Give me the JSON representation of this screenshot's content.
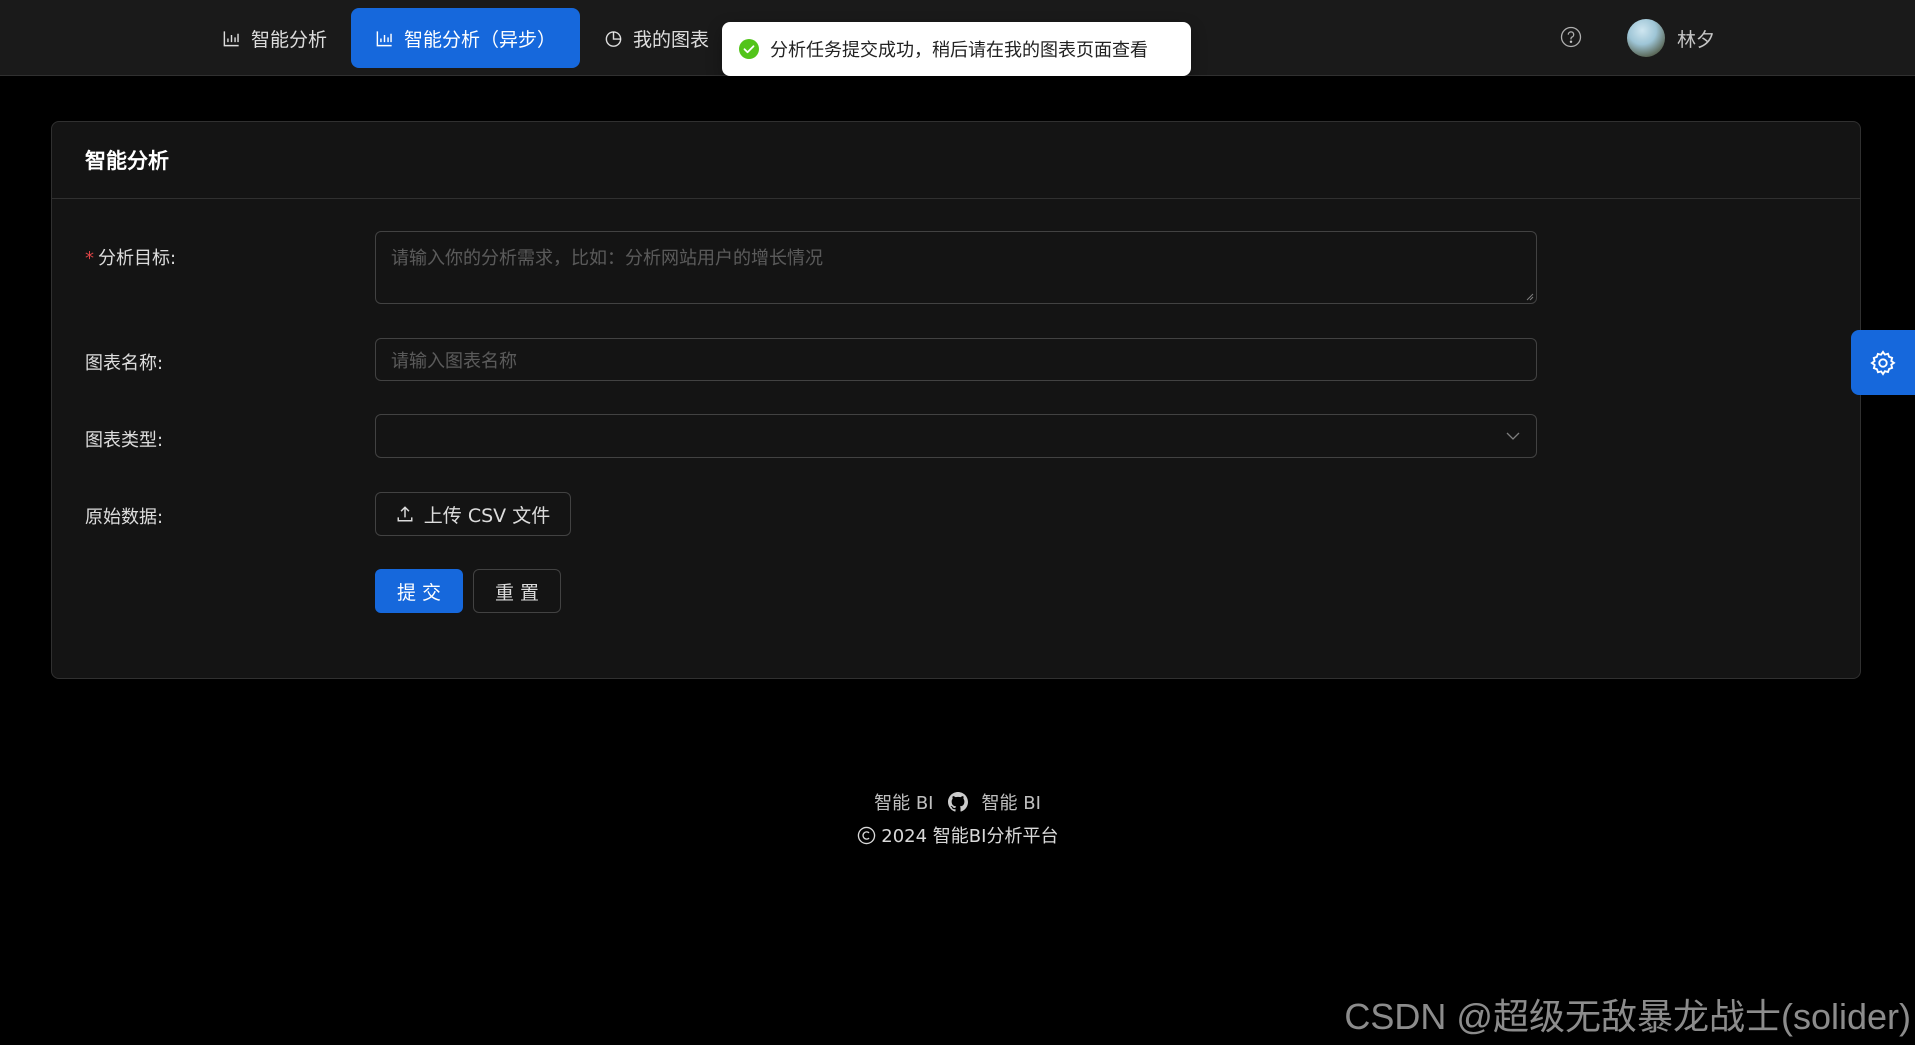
{
  "nav": {
    "items": [
      {
        "label": "智能分析",
        "icon": "bar-chart-icon"
      },
      {
        "label": "智能分析（异步）",
        "icon": "bar-chart-icon",
        "active": true
      },
      {
        "label": "我的图表",
        "icon": "pie-chart-icon"
      }
    ]
  },
  "toast": {
    "message": "分析任务提交成功，稍后请在我的图表页面查看",
    "icon": "check-circle-icon",
    "color": "#52c41a"
  },
  "user": {
    "name": "林夕"
  },
  "card": {
    "title": "智能分析"
  },
  "form": {
    "goal_label": "分析目标:",
    "goal_placeholder": "请输入你的分析需求，比如：分析网站用户的增长情况",
    "name_label": "图表名称:",
    "name_placeholder": "请输入图表名称",
    "type_label": "图表类型:",
    "data_label": "原始数据:",
    "upload_label": "上传 CSV 文件",
    "submit_label": "提 交",
    "reset_label": "重 置"
  },
  "footer": {
    "link1": "智能 BI",
    "link2": "智能 BI",
    "copyright": "2024 智能BI分析平台"
  },
  "watermark": "CSDN @超级无敌暴龙战士(solider)",
  "colors": {
    "primary": "#1668dc",
    "background": "#000000",
    "required": "#dc4446"
  }
}
